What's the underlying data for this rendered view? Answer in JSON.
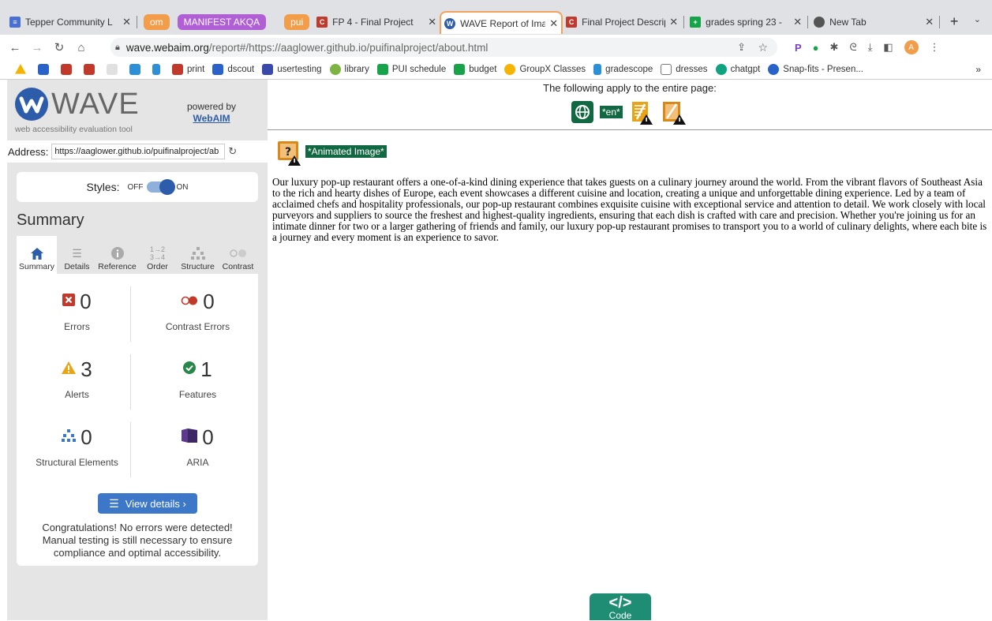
{
  "browser": {
    "tabs": [
      {
        "title": "Tepper Community L",
        "fav_color": "#4a6fd4",
        "type": "tab"
      },
      {
        "title": "om",
        "color": "#f29d4a",
        "type": "group"
      },
      {
        "title": "MANIFEST AKQA",
        "color": "#b05fd4",
        "type": "group"
      },
      {
        "title": "pui",
        "color": "#f29d4a",
        "type": "group"
      },
      {
        "title": "FP 4 - Final Project",
        "fav_color": "#c0392b",
        "type": "tab"
      },
      {
        "title": "WAVE Report of Ima",
        "fav_color": "#2d5daa",
        "type": "active"
      },
      {
        "title": "Final Project Descrip",
        "fav_color": "#c0392b",
        "type": "tab"
      },
      {
        "title": "grades spring 23 -",
        "fav_color": "#16a34a",
        "type": "tab"
      },
      {
        "title": "New Tab",
        "fav_color": "#555555",
        "type": "tab"
      }
    ],
    "new_tab": "+",
    "url_domain": "wave.webaim.org",
    "url_path": "/report#/https://aaglower.github.io/puifinalproject/about.html",
    "profile_initial": "A",
    "bookmarks": [
      {
        "label": "",
        "color": "#f5b400"
      },
      {
        "label": "",
        "color": "#2962c9"
      },
      {
        "label": "",
        "color": "#c0392b"
      },
      {
        "label": "",
        "color": "#c0392b"
      },
      {
        "label": "",
        "color": "#e0e0e0"
      },
      {
        "label": "",
        "color": "#2d8fd5"
      },
      {
        "label": "",
        "color": "#2d8fd5"
      },
      {
        "label": "print",
        "color": "#c0392b"
      },
      {
        "label": "dscout",
        "color": "#2962c9"
      },
      {
        "label": "usertesting",
        "color": "#3949ab"
      },
      {
        "label": "library",
        "color": "#7cb342"
      },
      {
        "label": "PUI schedule",
        "color": "#16a34a"
      },
      {
        "label": "budget",
        "color": "#16a34a"
      },
      {
        "label": "GroupX Classes",
        "color": "#f5b400"
      },
      {
        "label": "gradescope",
        "color": "#2d8fd5"
      },
      {
        "label": "dresses",
        "color": "#777777"
      },
      {
        "label": "chatgpt",
        "color": "#10a37f"
      },
      {
        "label": "Snap-fits - Presen...",
        "color": "#2962c9"
      }
    ],
    "more": "»"
  },
  "wave": {
    "logo": "WAVE",
    "tagline": "web accessibility evaluation tool",
    "powered_by": "powered by",
    "webaim": "WebAIM",
    "address_label": "Address:",
    "address_value": "https://aaglower.github.io/puifinalproject/ab",
    "styles_label": "Styles:",
    "off": "OFF",
    "on": "ON",
    "summary_title": "Summary",
    "tabs": [
      "Summary",
      "Details",
      "Reference",
      "Order",
      "Structure",
      "Contrast"
    ],
    "stats": {
      "errors": {
        "count": "0",
        "label": "Errors",
        "color": "#c0392b"
      },
      "contrast": {
        "count": "0",
        "label": "Contrast Errors",
        "color": "#c0392b"
      },
      "alerts": {
        "count": "3",
        "label": "Alerts",
        "color": "#e8a317"
      },
      "features": {
        "count": "1",
        "label": "Features",
        "color": "#27864a"
      },
      "structural": {
        "count": "0",
        "label": "Structural Elements",
        "color": "#3d78c8"
      },
      "aria": {
        "count": "0",
        "label": "ARIA",
        "color": "#5c3b8c"
      }
    },
    "view_details": "View details ›",
    "congrats": "Congratulations! No errors were detected! Manual testing is still necessary to ensure compliance and optimal accessibility."
  },
  "report": {
    "header": "The following apply to the entire page:",
    "lang_badge": "*en*",
    "animated_badge": "*Animated Image*",
    "paragraph": "Our luxury pop-up restaurant offers a one-of-a-kind dining experience that takes guests on a culinary journey around the world. From the vibrant flavors of Southeast Asia to the rich and hearty dishes of Europe, each event showcases a different cuisine and location, creating a unique and unforgettable dining experience. Led by a team of acclaimed chefs and hospitality professionals, our pop-up restaurant combines exquisite cuisine with exceptional service and attention to detail. We work closely with local purveyors and suppliers to source the freshest and highest-quality ingredients, ensuring that each dish is crafted with care and precision. Whether you're joining us for an intimate dinner for two or a larger gathering of friends and family, our luxury pop-up restaurant promises to transport you to a world of culinary delights, where each bite is a journey and every moment is an experience to savor.",
    "code_button": "Code",
    "code_symbol": "</>"
  }
}
